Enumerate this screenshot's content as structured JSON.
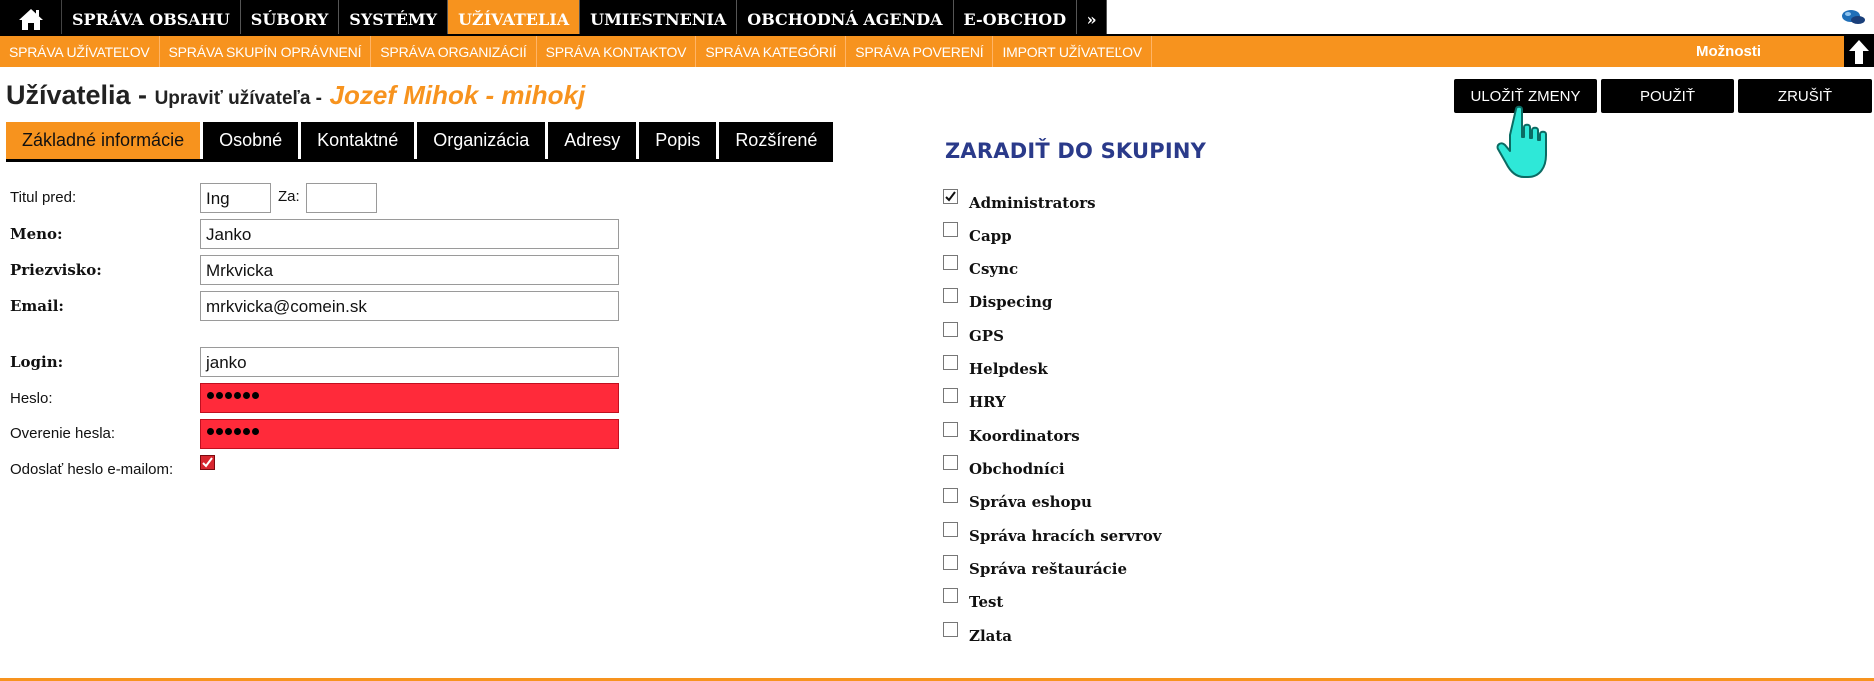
{
  "topnav": {
    "items": [
      "SPRÁVA OBSAHU",
      "SÚBORY",
      "SYSTÉMY",
      "UŽÍVATELIA",
      "UMIESTNENIA",
      "OBCHODNÁ AGENDA",
      "E-OBCHOD"
    ],
    "more": "»",
    "active_index": 3
  },
  "subnav": {
    "items": [
      "SPRÁVA UŽÍVATEĽOV",
      "SPRÁVA SKUPÍN OPRÁVNENÍ",
      "SPRÁVA ORGANIZÁCIÍ",
      "SPRÁVA KONTAKTOV",
      "SPRÁVA KATEGÓRIÍ",
      "SPRÁVA POVERENÍ",
      "IMPORT UŽÍVATEĽOV"
    ],
    "options": "Možnosti"
  },
  "title": {
    "main": "Užívatelia -",
    "sub": "Upraviť užívateľa -",
    "user": "Jozef Mihok - mihokj"
  },
  "actions": {
    "save": "ULOŽIŤ ZMENY",
    "apply": "POUŽIŤ",
    "cancel": "ZRUŠIŤ"
  },
  "tabs": [
    "Základné informácie",
    "Osobné",
    "Kontaktné",
    "Organizácia",
    "Adresy",
    "Popis",
    "Rozšírené"
  ],
  "form": {
    "title_before_label": "Titul pred:",
    "title_before_value": "Ing",
    "title_after_label": "Za:",
    "title_after_value": "",
    "name_label": "Meno:",
    "name_value": "Janko",
    "surname_label": "Priezvisko:",
    "surname_value": "Mrkvicka",
    "email_label": "Email:",
    "email_value": "mrkvicka@comein.sk",
    "login_label": "Login:",
    "login_value": "janko",
    "password_label": "Heslo:",
    "password_confirm_label": "Overenie hesla:",
    "send_password_label": "Odoslať heslo e-mailom:",
    "send_password_checked": true
  },
  "groups": {
    "title": "ZARADIŤ DO SKUPINY",
    "items": [
      {
        "label": "Administrators",
        "checked": true
      },
      {
        "label": "Capp",
        "checked": false
      },
      {
        "label": "Csync",
        "checked": false
      },
      {
        "label": "Dispecing",
        "checked": false
      },
      {
        "label": "GPS",
        "checked": false
      },
      {
        "label": "Helpdesk",
        "checked": false
      },
      {
        "label": "HRY",
        "checked": false
      },
      {
        "label": "Koordinators",
        "checked": false
      },
      {
        "label": "Obchodníci",
        "checked": false
      },
      {
        "label": "Správa eshopu",
        "checked": false
      },
      {
        "label": "Správa hracích servrov",
        "checked": false
      },
      {
        "label": "Správa reštaurácie",
        "checked": false
      },
      {
        "label": "Test",
        "checked": false
      },
      {
        "label": "Zlata",
        "checked": false
      }
    ]
  },
  "colors": {
    "accent": "#f7931e",
    "nav_bg": "#000000",
    "error_field": "#ff2a3a",
    "groups_title": "#2a3a8a",
    "cursor": "#2ee8d8"
  }
}
